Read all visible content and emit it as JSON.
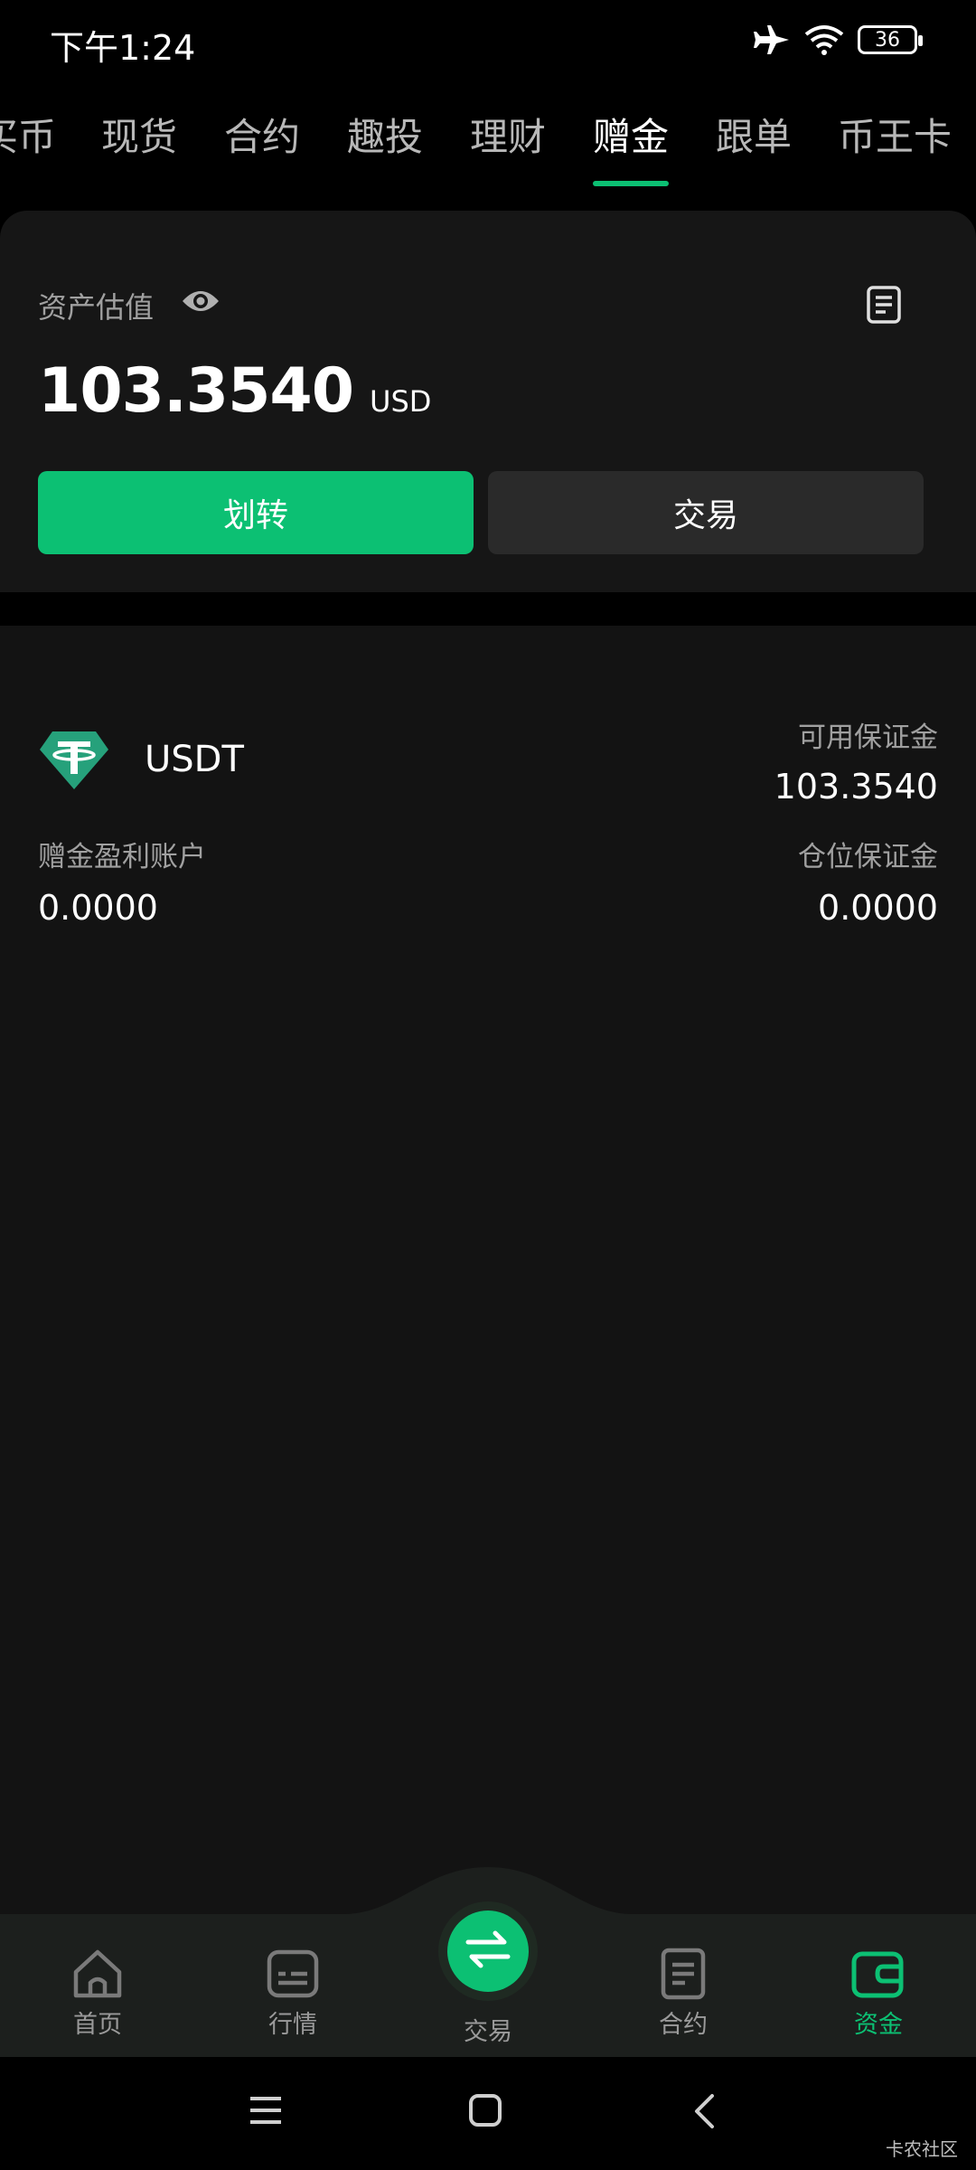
{
  "status_bar": {
    "time": "下午1:24",
    "battery": "36"
  },
  "tabs": [
    {
      "label": "买币",
      "active": false
    },
    {
      "label": "现货",
      "active": false
    },
    {
      "label": "合约",
      "active": false
    },
    {
      "label": "趣投",
      "active": false
    },
    {
      "label": "理财",
      "active": false
    },
    {
      "label": "赠金",
      "active": true
    },
    {
      "label": "跟单",
      "active": false
    },
    {
      "label": "币王卡",
      "active": false
    }
  ],
  "asset": {
    "label": "资产估值",
    "value": "103.3540",
    "unit": "USD",
    "transfer_label": "划转",
    "trade_label": "交易"
  },
  "account": {
    "coin": "USDT",
    "available_margin_label": "可用保证金",
    "available_margin_value": "103.3540",
    "bonus_profit_label": "赠金盈利账户",
    "bonus_profit_value": "0.0000",
    "position_margin_label": "仓位保证金",
    "position_margin_value": "0.0000"
  },
  "bottom_nav": [
    {
      "label": "首页",
      "icon": "home-icon",
      "active": false
    },
    {
      "label": "行情",
      "icon": "market-icon",
      "active": false
    },
    {
      "label": "交易",
      "icon": "swap-icon",
      "active": false
    },
    {
      "label": "合约",
      "icon": "contract-icon",
      "active": false
    },
    {
      "label": "资金",
      "icon": "wallet-icon",
      "active": true
    }
  ],
  "watermark": "卡农社区",
  "colors": {
    "accent": "#0cc073",
    "background": "#000000",
    "card": "#161616",
    "tether": "#26a17b"
  }
}
